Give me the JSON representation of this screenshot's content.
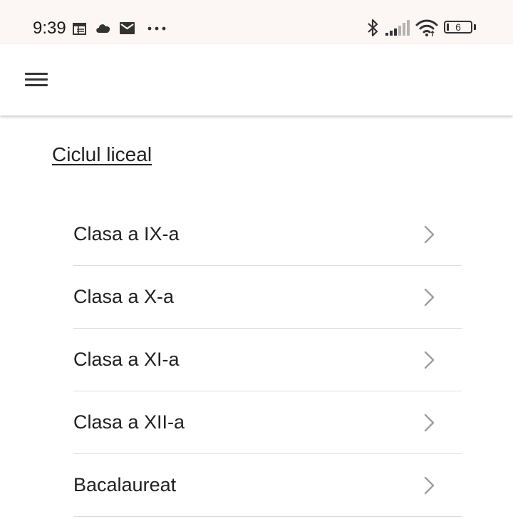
{
  "status_bar": {
    "time": "9:39",
    "battery_level": "6",
    "icons": [
      "calendar-icon",
      "cloud-icon",
      "mail-icon",
      "more-dots-icon",
      "bluetooth-icon",
      "signal-icon",
      "wifi-icon",
      "battery-icon"
    ]
  },
  "app_bar": {
    "menu_icon": "hamburger-menu-icon"
  },
  "section": {
    "title": "Ciclul liceal"
  },
  "list": {
    "items": [
      {
        "label": "Clasa a IX-a"
      },
      {
        "label": "Clasa a X-a"
      },
      {
        "label": "Clasa a XI-a"
      },
      {
        "label": "Clasa a XII-a"
      },
      {
        "label": "Bacalaureat"
      }
    ],
    "chevron_icon": "chevron-right-icon"
  },
  "colors": {
    "status_bar_bg": "#fcf6f4",
    "text": "#212121",
    "divider": "#dcdcdc",
    "chevron": "#9e9e9e"
  }
}
